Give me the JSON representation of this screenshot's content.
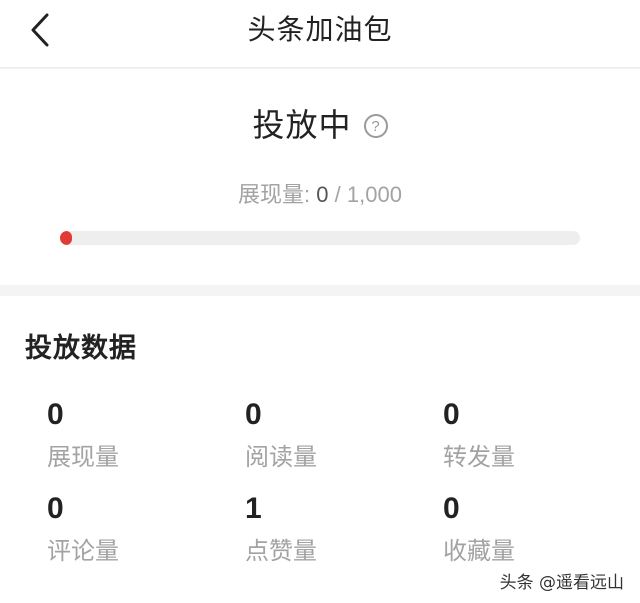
{
  "header": {
    "title": "头条加油包",
    "back_icon": "chevron-left-icon"
  },
  "status": {
    "title": "投放中",
    "help_icon": "?",
    "impressions_label": "展现量: ",
    "impressions_current": "0",
    "impressions_separator": " / ",
    "impressions_target": "1,000",
    "progress_fraction": 0.0,
    "accent_color": "#e13b37"
  },
  "data_section": {
    "title": "投放数据",
    "stats": [
      {
        "value": "0",
        "label": "展现量"
      },
      {
        "value": "0",
        "label": "阅读量"
      },
      {
        "value": "0",
        "label": "转发量"
      },
      {
        "value": "0",
        "label": "评论量"
      },
      {
        "value": "1",
        "label": "点赞量"
      },
      {
        "value": "0",
        "label": "收藏量"
      }
    ]
  },
  "watermark": "头条 @遥看远山"
}
